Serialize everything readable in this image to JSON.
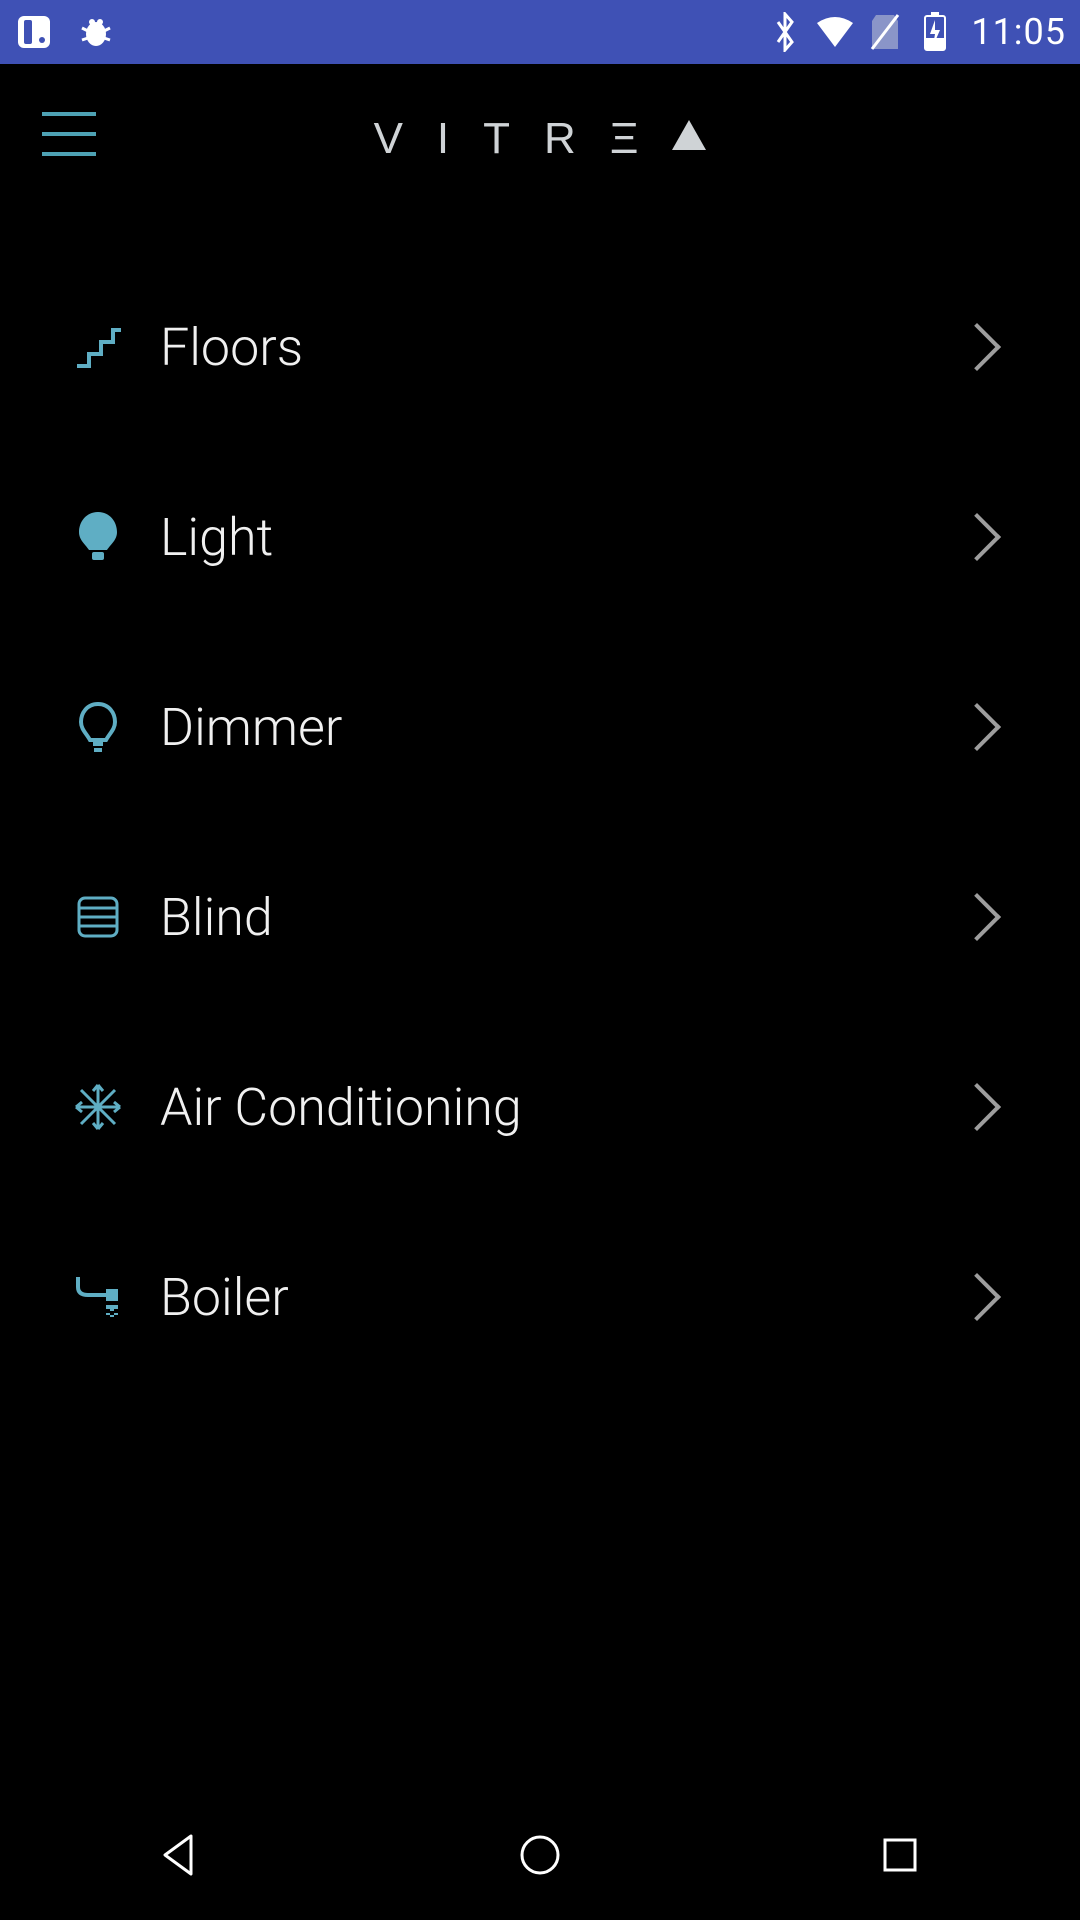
{
  "status": {
    "time": "11:05"
  },
  "brand": {
    "letters": [
      "V",
      "I",
      "T",
      "R",
      "Ξ"
    ]
  },
  "menu": {
    "items": [
      {
        "label": "Floors",
        "icon": "stairs-icon"
      },
      {
        "label": "Light",
        "icon": "bulb-icon"
      },
      {
        "label": "Dimmer",
        "icon": "bulb-outline-icon"
      },
      {
        "label": "Blind",
        "icon": "blind-icon"
      },
      {
        "label": "Air Conditioning",
        "icon": "snowflake-icon"
      },
      {
        "label": "Boiler",
        "icon": "shower-icon"
      }
    ]
  }
}
